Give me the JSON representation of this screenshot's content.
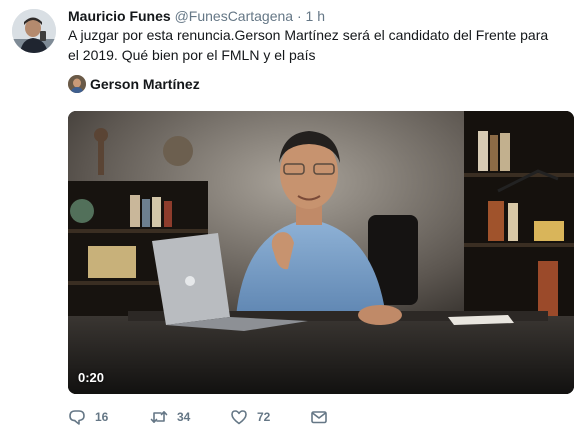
{
  "tweet": {
    "author_name": "Mauricio Funes",
    "handle": "@FunesCartagena",
    "separator": "·",
    "time": "1 h",
    "text": "A juzgar por esta renuncia.Gerson Martínez será el candidato del Frente para el 2019. Qué bien por el FMLN y el país"
  },
  "card": {
    "author_name": "Gerson Martínez",
    "video_duration": "0:20"
  },
  "actions": {
    "replies": "16",
    "retweets": "34",
    "likes": "72"
  },
  "icons": {
    "reply": "reply-icon",
    "retweet": "retweet-icon",
    "like": "heart-icon",
    "message": "direct-message-icon"
  },
  "colors": {
    "text": "#14171a",
    "secondary": "#657786"
  }
}
